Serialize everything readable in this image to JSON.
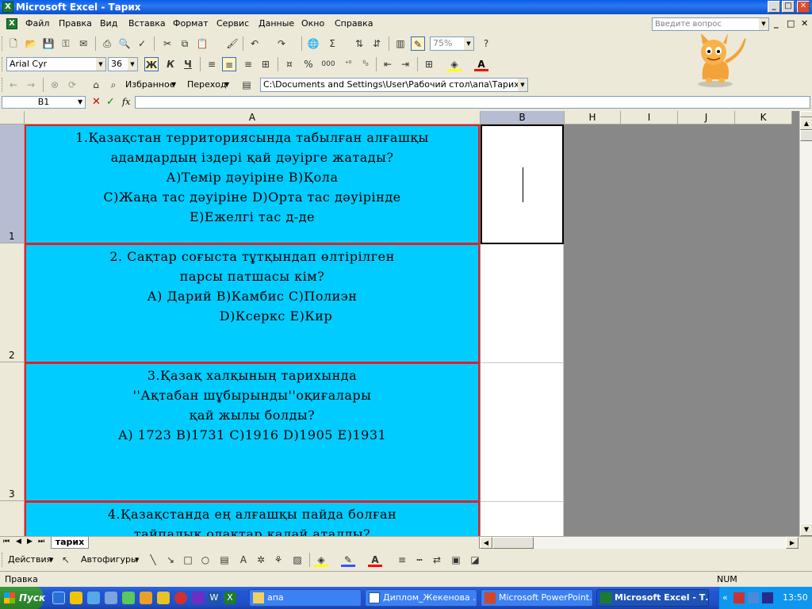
{
  "window": {
    "title": "Microsoft Excel - Тарих",
    "min_label": "_",
    "max_label": "□",
    "close_label": "✕"
  },
  "menu": {
    "items": [
      "Файл",
      "Правка",
      "Вид",
      "Вставка",
      "Формат",
      "Сервис",
      "Данные",
      "Окно",
      "Справка"
    ],
    "ask_placeholder": "Введите вопрос",
    "doc_min_label": "_",
    "doc_restore_label": "□",
    "doc_close_label": "✕"
  },
  "toolbar": {
    "zoom": "75%",
    "font_name": "Arial Cyr",
    "font_size": "36",
    "bold": "Ж",
    "italic": "К",
    "underline": "Ч",
    "percent": "%",
    "thousands": "000",
    "favorites": "Избранное",
    "goto": "Переход",
    "path": "C:\\Documents and Settings\\User\\Рабочий стол\\апа\\Тарих.xls"
  },
  "formula": {
    "name_box": "B1",
    "fx": "fx",
    "cancel": "✕",
    "enter": "✓"
  },
  "columns": {
    "A": "A",
    "B": "B",
    "H": "H",
    "I": "I",
    "J": "J",
    "K": "K"
  },
  "rows": [
    {
      "num": "1",
      "lines": [
        "1.Қазақстан территориясында табылған алғашқы",
        "адамдардың іздері қай дәуірге жатады?",
        "А)Темір дәуіріне    В)Қола",
        "С)Жаңа тас дәуіріне  D)Орта тас дәуірінде",
        "Е)Ежелгі тас д-де"
      ]
    },
    {
      "num": "2",
      "lines": [
        "2. Сақтар соғыста тұтқындап өлтірілген",
        "парсы патшасы кім?",
        "А) Дарий  В)Камбис  С)Полиэн",
        "D)Ксеркс   Е)Кир"
      ]
    },
    {
      "num": "3",
      "lines": [
        "3.Қазақ халқының тарихында",
        "''Ақтабан шұбырынды''оқиғалары",
        "қай жылы болды?",
        "А) 1723 В)1731 С)1916 D)1905 Е)1931"
      ]
    },
    {
      "num": "",
      "lines": [
        "4.Қазақстанда ең алғашқы  пайда болған",
        "тайпалық одақтар қалай аталды?"
      ]
    }
  ],
  "sheet_tab": "тарих",
  "drawing": {
    "actions": "Действия",
    "autoshapes": "Автофигуры"
  },
  "status": {
    "mode": "Правка",
    "num": "NUM"
  },
  "taskbar": {
    "start": "Пуск",
    "tasks": [
      {
        "label": "апа",
        "active": false
      },
      {
        "label": "Диплом_Жекенова ...",
        "active": false
      },
      {
        "label": "Microsoft PowerPoint...",
        "active": false
      },
      {
        "label": "Microsoft Excel - Т...",
        "active": true
      }
    ],
    "lang": "EN",
    "tray_arrow": "«",
    "clock": "13:50"
  },
  "colors": {
    "cell_fill": "#00ccff",
    "cell_border": "#e0202a",
    "selection_header": "#b6bdd2"
  }
}
